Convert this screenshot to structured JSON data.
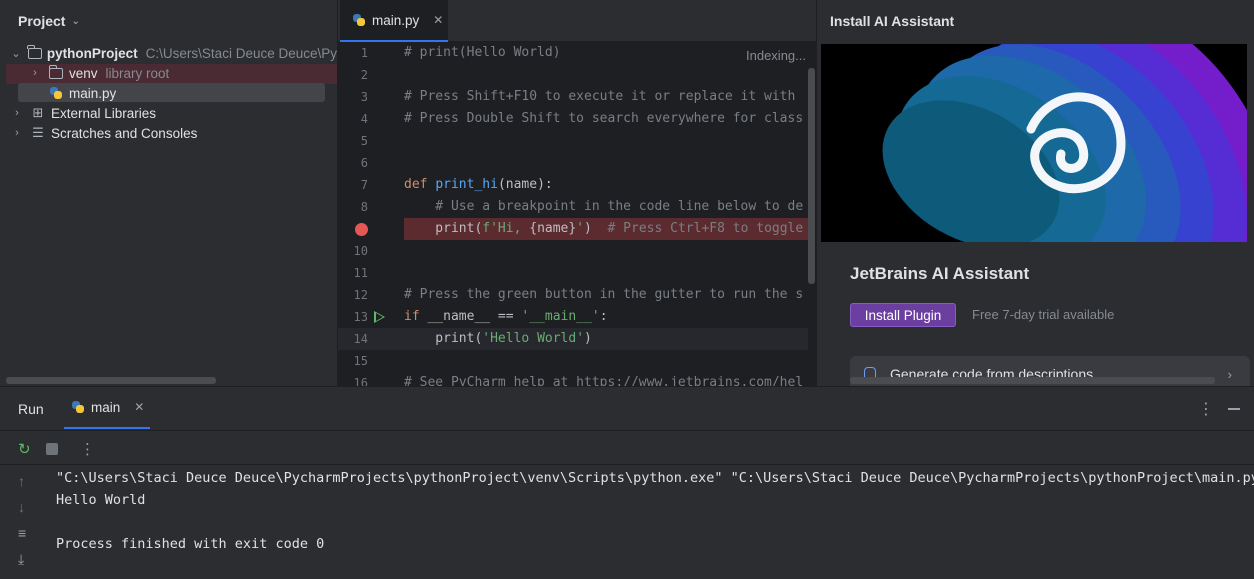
{
  "project": {
    "title": "Project",
    "tree": [
      {
        "label": "pythonProject",
        "sub": "C:\\Users\\Staci Deuce Deuce\\Py"
      },
      {
        "label": "venv",
        "sub": "library root"
      },
      {
        "label": "main.py",
        "sub": ""
      },
      {
        "label": "External Libraries",
        "sub": ""
      },
      {
        "label": "Scratches and Consoles",
        "sub": ""
      }
    ]
  },
  "editor": {
    "tab_label": "main.py",
    "status": "Indexing...",
    "line_numbers": [
      "1",
      "2",
      "3",
      "4",
      "5",
      "6",
      "7",
      "8",
      "9",
      "10",
      "11",
      "12",
      "13",
      "14",
      "15",
      "16"
    ],
    "lines": {
      "l1": "# print(Hello World)",
      "l3": "# Press Shift+F10 to execute it or replace it with",
      "l4": "# Press Double Shift to search everywhere for class",
      "l7_kw": "def ",
      "l7_fn": "print_hi",
      "l7_rest": "(name):",
      "l8": "    # Use a breakpoint in the code line below to de",
      "l9_a": "    print(",
      "l9_b": "f'Hi, ",
      "l9_c": "{name}",
      "l9_d": "'",
      "l9_e": ")  ",
      "l9_cm": "# Press Ctrl+F8 to toggle",
      "l12": "# Press the green button in the gutter to run the s",
      "l13_kw": "if ",
      "l13_a": "__name__ == ",
      "l13_st": "'__main__'",
      "l13_b": ":",
      "l14_a": "    print(",
      "l14_st": "'Hello World'",
      "l14_b": ")",
      "l16": "# See PyCharm help at https://www.jetbrains.com/hel"
    }
  },
  "ai_panel": {
    "title": "Install AI Assistant",
    "product": "JetBrains AI Assistant",
    "install_button": "Install Plugin",
    "trial_note": "Free 7-day trial available",
    "feature": "Generate code from descriptions"
  },
  "run": {
    "label": "Run",
    "tab_label": "main",
    "console": [
      "\"C:\\Users\\Staci Deuce Deuce\\PycharmProjects\\pythonProject\\venv\\Scripts\\python.exe\" \"C:\\Users\\Staci Deuce Deuce\\PycharmProjects\\pythonProject\\main.py\"",
      "Hello World",
      "",
      "Process finished with exit code 0"
    ]
  }
}
